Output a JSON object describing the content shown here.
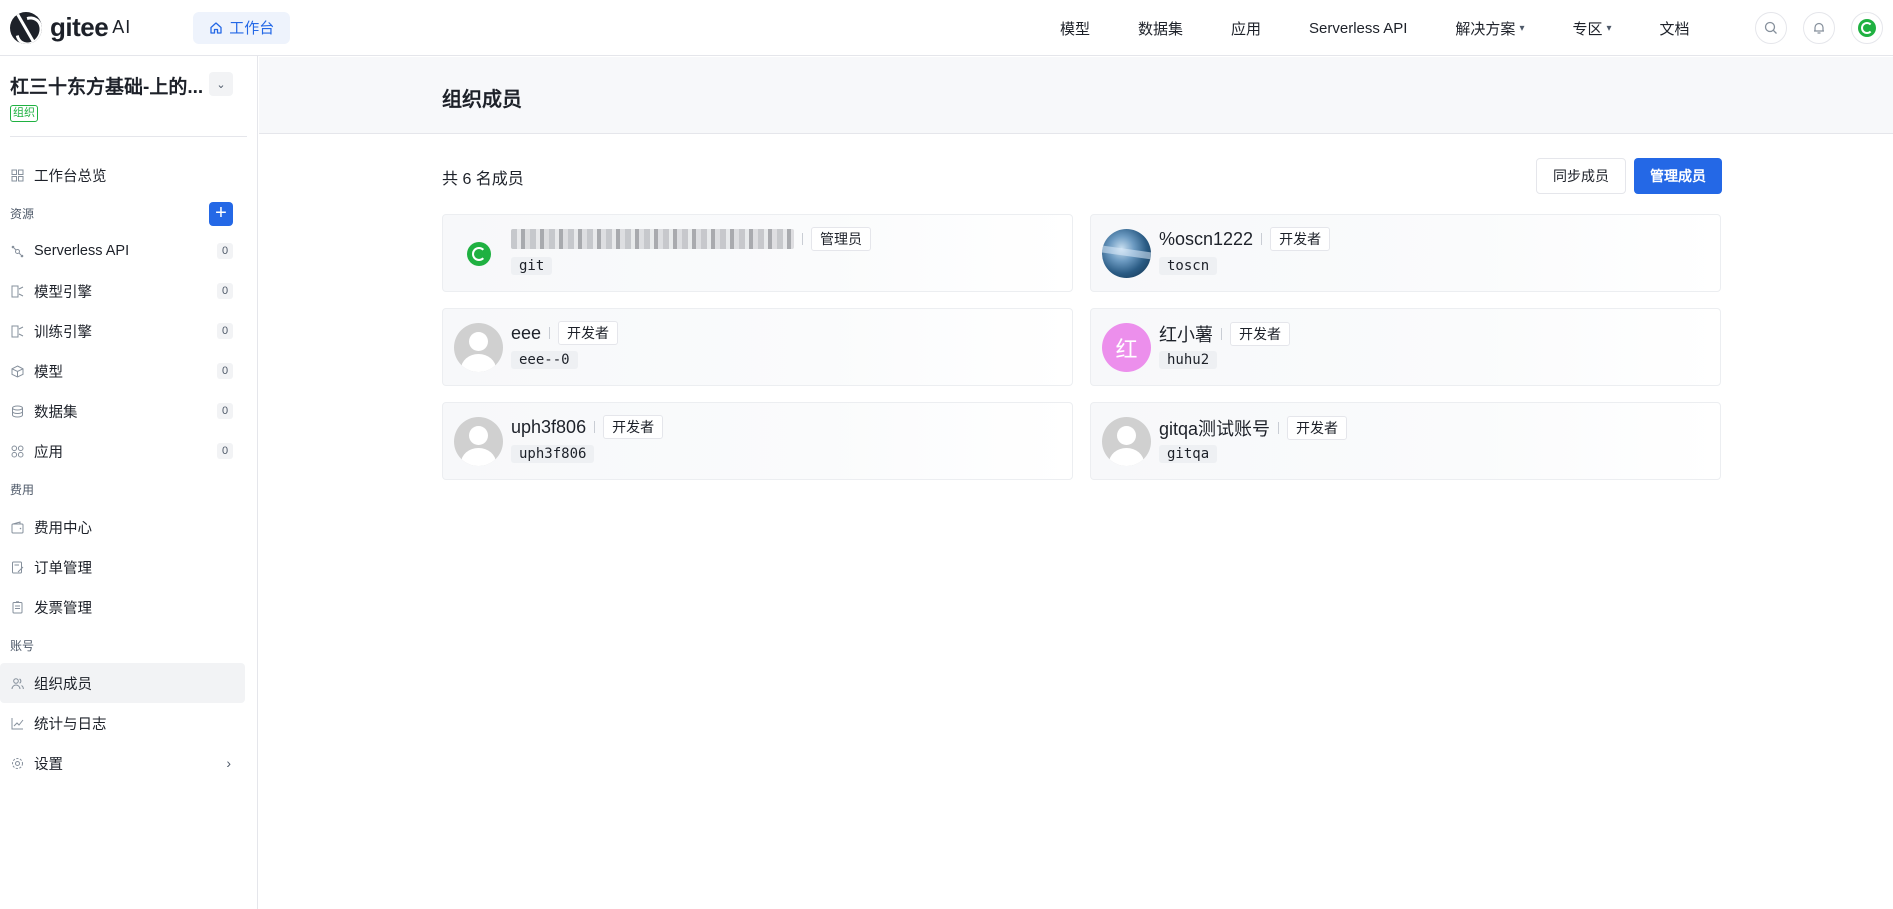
{
  "brand": {
    "logo_text": "gitee",
    "logo_suffix": "AI"
  },
  "header": {
    "workbench_label": "工作台",
    "nav": [
      {
        "label": "模型",
        "dropdown": false
      },
      {
        "label": "数据集",
        "dropdown": false
      },
      {
        "label": "应用",
        "dropdown": false
      },
      {
        "label": "Serverless API",
        "dropdown": false
      },
      {
        "label": "解决方案",
        "dropdown": true
      },
      {
        "label": "专区",
        "dropdown": true
      },
      {
        "label": "文档",
        "dropdown": false
      }
    ],
    "icons": [
      "search-icon",
      "bell-icon",
      "user-avatar"
    ]
  },
  "sidebar": {
    "org_name": "杠三十东方基础-上的...",
    "org_badge": "组织",
    "overview_label": "工作台总览",
    "groups": {
      "resources": "资源",
      "billing": "费用",
      "account": "账号"
    },
    "resources": [
      {
        "label": "Serverless API",
        "count": "0"
      },
      {
        "label": "模型引擎",
        "count": "0"
      },
      {
        "label": "训练引擎",
        "count": "0"
      },
      {
        "label": "模型",
        "count": "0"
      },
      {
        "label": "数据集",
        "count": "0"
      },
      {
        "label": "应用",
        "count": "0"
      }
    ],
    "billing": [
      {
        "label": "费用中心"
      },
      {
        "label": "订单管理"
      },
      {
        "label": "发票管理"
      }
    ],
    "account": [
      {
        "label": "组织成员",
        "active": true
      },
      {
        "label": "统计与日志"
      },
      {
        "label": "设置"
      }
    ],
    "add_symbol": "+"
  },
  "main": {
    "title": "组织成员",
    "count_text": "共 6 名成员",
    "sync_button": "同步成员",
    "manage_button": "管理成员",
    "members": [
      {
        "name": "",
        "name_blurred": true,
        "role": "管理员",
        "uid": "git",
        "avatar": "green-g"
      },
      {
        "name": "%oscn1222",
        "role": "开发者",
        "uid": "toscn",
        "avatar": "planet"
      },
      {
        "name": "eee",
        "role": "开发者",
        "uid": "eee--0",
        "avatar": "default"
      },
      {
        "name": "红小薯",
        "role": "开发者",
        "uid": "huhu2",
        "avatar": "letter",
        "avatar_letter": "红"
      },
      {
        "name": "uph3f806",
        "role": "开发者",
        "uid": "uph3f806",
        "avatar": "default"
      },
      {
        "name": "gitqa测试账号",
        "role": "开发者",
        "uid": "gitqa",
        "avatar": "default"
      }
    ]
  },
  "colors": {
    "primary": "#2468e6",
    "success": "#1fb141",
    "border": "#e5e6eb"
  }
}
